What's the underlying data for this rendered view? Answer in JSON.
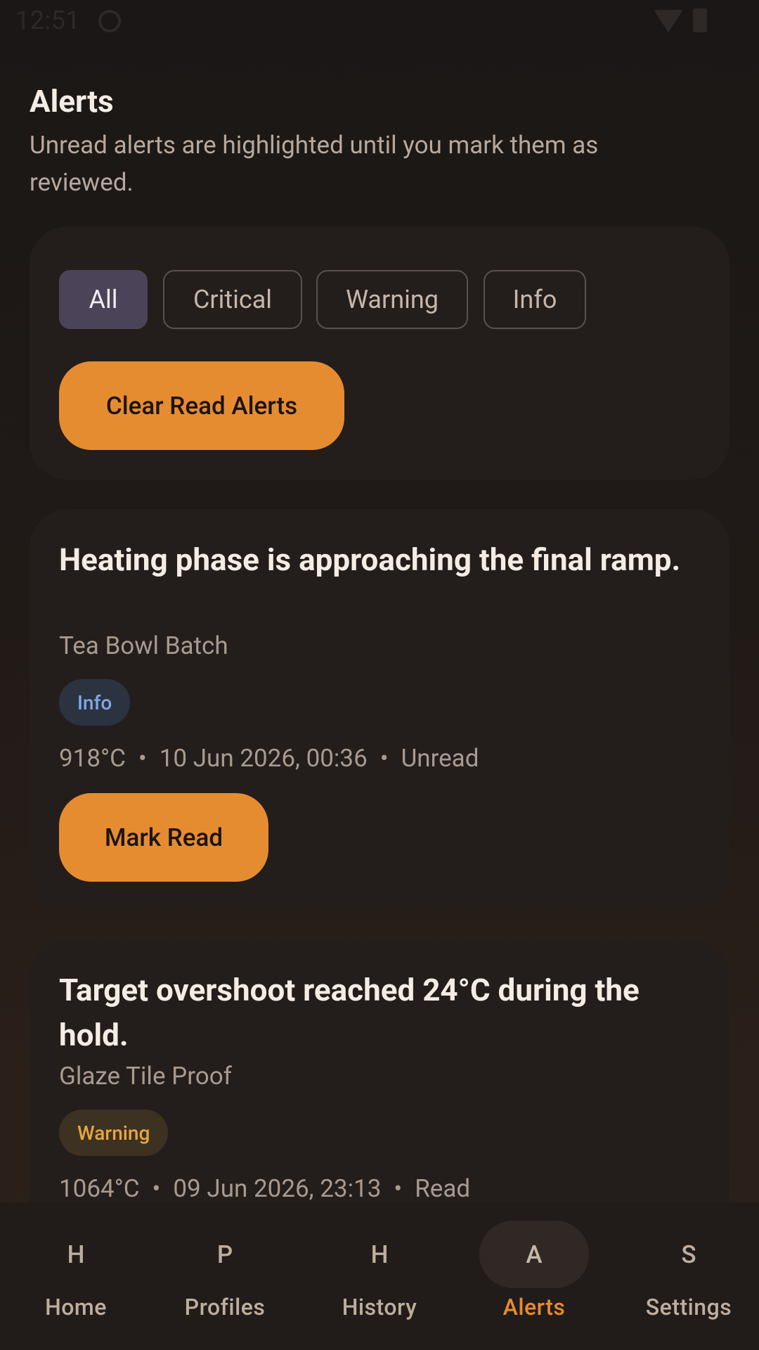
{
  "status_bar": {
    "time": "12:51"
  },
  "header": {
    "title": "Alerts",
    "subtitle": "Unread alerts are highlighted until you mark them as reviewed."
  },
  "filters": {
    "chips": [
      "All",
      "Critical",
      "Warning",
      "Info"
    ],
    "selected": "All",
    "clear_label": "Clear Read Alerts"
  },
  "alerts": [
    {
      "title": "Heating phase is approaching the final ramp.",
      "source": "Tea Bowl Batch",
      "level": "Info",
      "temperature": "918°C",
      "timestamp": "10 Jun 2026, 00:36",
      "status": "Unread",
      "action_label": "Mark Read"
    },
    {
      "title": "Target overshoot reached 24°C during the hold.",
      "source": "Glaze Tile Proof",
      "level": "Warning",
      "temperature": "1064°C",
      "timestamp": "09 Jun 2026, 23:13",
      "status": "Read"
    }
  ],
  "meta_separator": "•",
  "nav": {
    "items": [
      {
        "icon": "H",
        "label": "Home"
      },
      {
        "icon": "P",
        "label": "Profiles"
      },
      {
        "icon": "H",
        "label": "History"
      },
      {
        "icon": "A",
        "label": "Alerts"
      },
      {
        "icon": "S",
        "label": "Settings"
      }
    ],
    "active": "Alerts"
  },
  "colors": {
    "accent": "#e68c30",
    "info_badge": "#7fa9e8",
    "warning_badge": "#e5a640",
    "selected_chip": "#4b4458"
  }
}
